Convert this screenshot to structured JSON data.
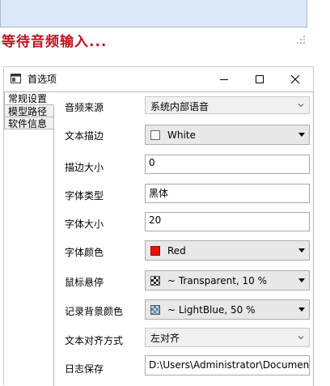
{
  "status": {
    "waiting_text": "等待音频输入..."
  },
  "dialog": {
    "title": "首选项",
    "controls": {
      "minimize": "minimize-icon",
      "maximize": "maximize-icon",
      "close": "close-icon"
    }
  },
  "tabs": [
    {
      "label": "常规设置",
      "active": true
    },
    {
      "label": "模型路径",
      "active": false
    },
    {
      "label": "软件信息",
      "active": false
    }
  ],
  "settings": {
    "audio_source": {
      "label": "音频来源",
      "value": "系统内部语音"
    },
    "text_stroke": {
      "label": "文本描边",
      "value": "White",
      "swatch": "#ffffff"
    },
    "stroke_size": {
      "label": "描边大小",
      "value": "0"
    },
    "font_type": {
      "label": "字体类型",
      "value": "黑体"
    },
    "font_size": {
      "label": "字体大小",
      "value": "20"
    },
    "font_color": {
      "label": "字体颜色",
      "value": "Red",
      "swatch": "#e3120b"
    },
    "mouse_hover": {
      "label": "鼠标悬停",
      "value": "~ Transparent, 10 %"
    },
    "record_bg_color": {
      "label": "记录背景颜色",
      "value": "~ LightBlue, 50 %",
      "swatch": "#add8e6"
    },
    "text_align": {
      "label": "文本对齐方式",
      "value": "左对齐"
    },
    "log_save": {
      "label": "日志保存",
      "value": "D:\\Users\\Administrator\\Documents"
    }
  }
}
